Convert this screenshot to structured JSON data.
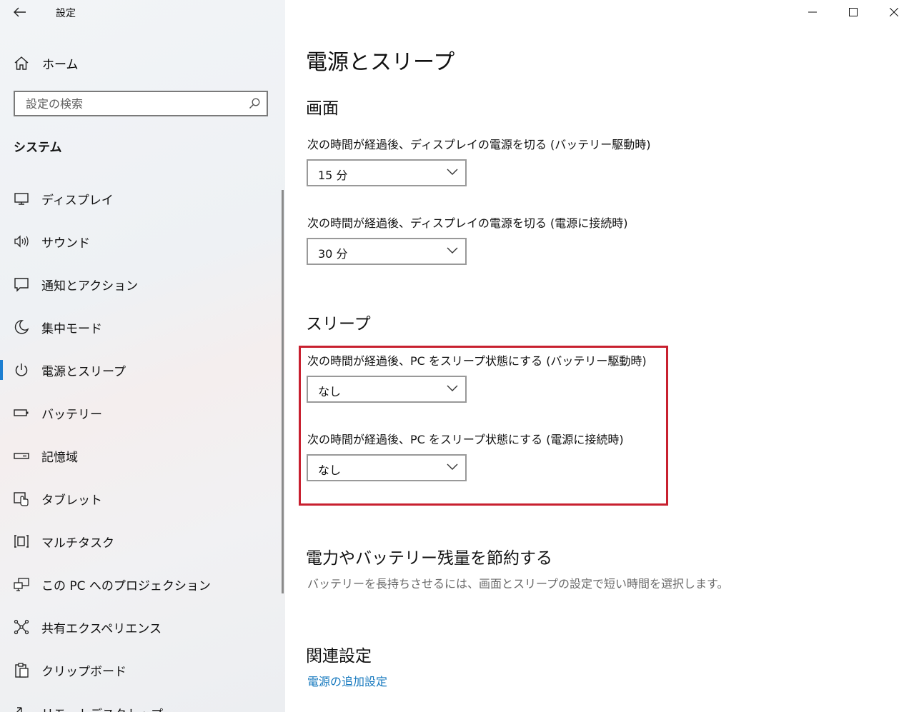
{
  "window": {
    "title": "設定",
    "back_icon": "back-arrow-icon",
    "controls": [
      "minimize-icon",
      "maximize-icon",
      "close-icon"
    ]
  },
  "sidebar": {
    "home_label": "ホーム",
    "search_placeholder": "設定の検索",
    "section_label": "システム",
    "items": [
      {
        "label": "ディスプレイ",
        "icon": "monitor-icon"
      },
      {
        "label": "サウンド",
        "icon": "speaker-icon"
      },
      {
        "label": "通知とアクション",
        "icon": "notification-icon"
      },
      {
        "label": "集中モード",
        "icon": "moon-icon"
      },
      {
        "label": "電源とスリープ",
        "icon": "power-icon",
        "active": true
      },
      {
        "label": "バッテリー",
        "icon": "battery-icon"
      },
      {
        "label": "記憶域",
        "icon": "storage-icon"
      },
      {
        "label": "タブレット",
        "icon": "tablet-icon"
      },
      {
        "label": "マルチタスク",
        "icon": "multitask-icon"
      },
      {
        "label": "この PC へのプロジェクション",
        "icon": "projection-icon"
      },
      {
        "label": "共有エクスペリエンス",
        "icon": "share-icon"
      },
      {
        "label": "クリップボード",
        "icon": "clipboard-icon"
      },
      {
        "label": "リモートデスクトップ",
        "icon": "remote-desktop-icon"
      }
    ]
  },
  "main": {
    "title": "電源とスリープ",
    "screen": {
      "heading": "画面",
      "battery_label": "次の時間が経過後、ディスプレイの電源を切る (バッテリー駆動時)",
      "battery_value": "15 分",
      "plugged_label": "次の時間が経過後、ディスプレイの電源を切る (電源に接続時)",
      "plugged_value": "30 分"
    },
    "sleep": {
      "heading": "スリープ",
      "battery_label": "次の時間が経過後、PC をスリープ状態にする (バッテリー駆動時)",
      "battery_value": "なし",
      "plugged_label": "次の時間が経過後、PC をスリープ状態にする (電源に接続時)",
      "plugged_value": "なし"
    },
    "save": {
      "heading": "電力やバッテリー残量を節約する",
      "description": "バッテリーを長持ちさせるには、画面とスリープの設定で短い時間を選択します。"
    },
    "related": {
      "heading": "関連設定",
      "link": "電源の追加設定"
    }
  },
  "colors": {
    "accent": "#1d7fd1",
    "link": "#1578be",
    "highlight": "#c8202f"
  }
}
